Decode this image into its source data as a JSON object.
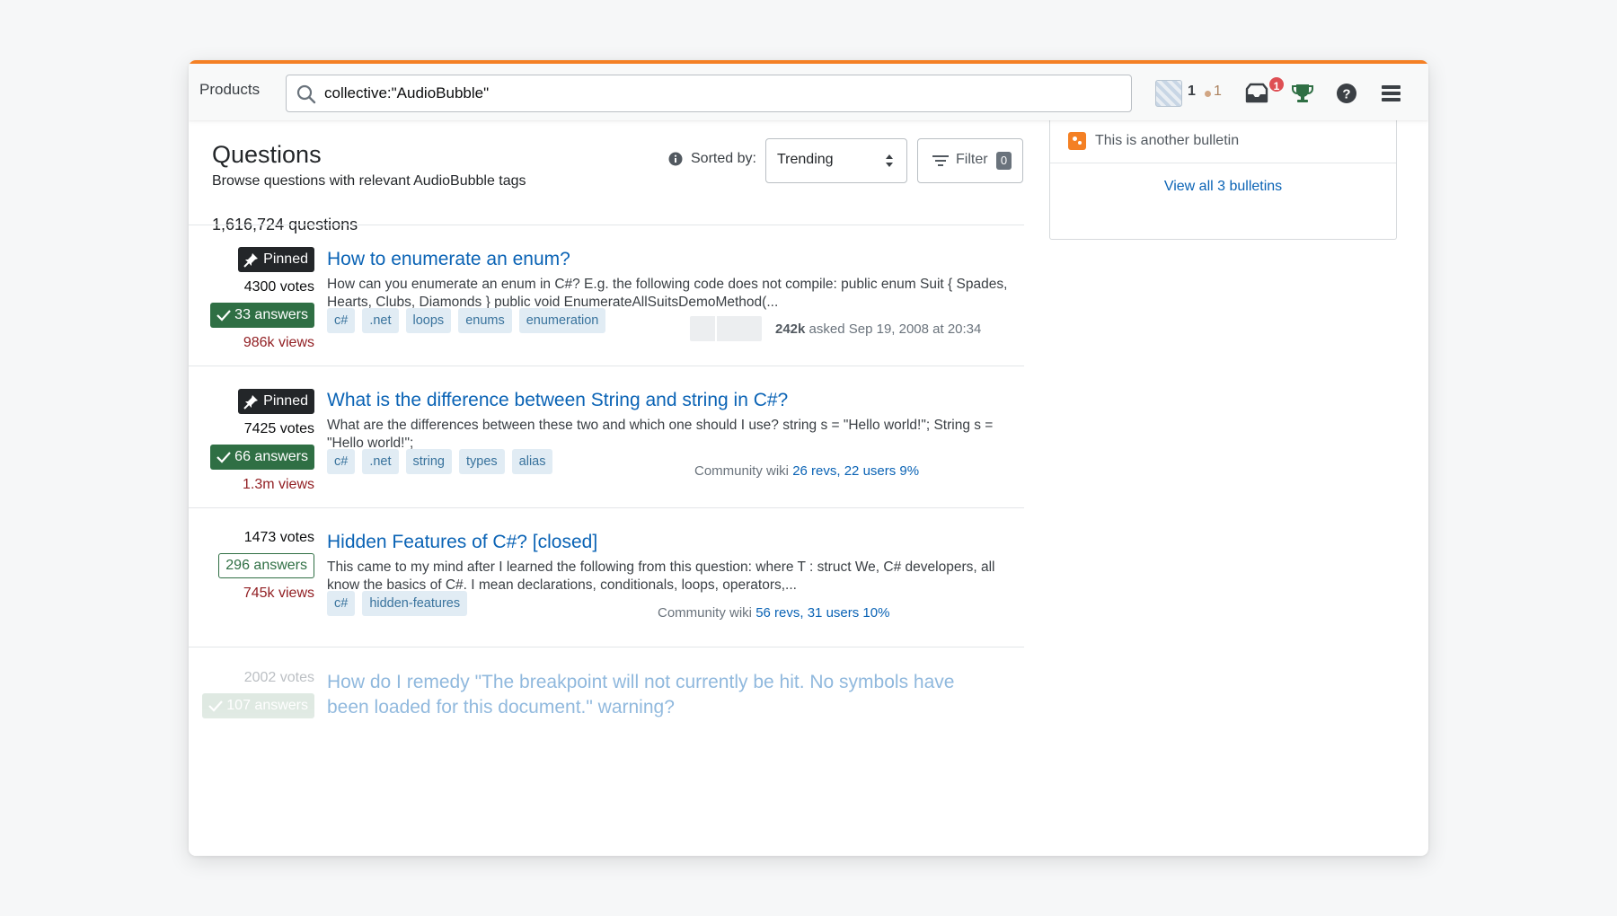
{
  "header": {
    "products_label": "Products",
    "search": {
      "value": "collective:\"AudioBubble\"",
      "placeholder": ""
    },
    "reputation": "1",
    "bronze_badges": "1",
    "inbox_count": "1",
    "icons": [
      "search-icon",
      "avatar",
      "inbox-icon",
      "trophy-icon",
      "help-icon",
      "hamburger-icon"
    ],
    "accent_color": "#f48024"
  },
  "main": {
    "title": "Questions",
    "subtitle": "Browse questions with relevant AudioBubble tags",
    "count": "1,616,724 questions",
    "sorted_by_label": "Sorted by:",
    "sort_value": "Trending",
    "filter_label": "Filter",
    "filter_count": "0"
  },
  "questions": [
    {
      "pinned_label": "Pinned",
      "votes": "4300 votes",
      "answers": "33 answers",
      "views": "986k views",
      "title": "How to enumerate an enum?",
      "excerpt": "How can you enumerate an enum in C#? E.g. the following code does not compile: public enum Suit { Spades, Hearts, Clubs, Diamonds } public void EnumerateAllSuitsDemoMethod(...",
      "tags": [
        "c#",
        ".net",
        "loops",
        "enums",
        "enumeration"
      ],
      "owner_rep": "242k",
      "owner_meta": "asked Sep 19, 2008 at 20:34"
    },
    {
      "pinned_label": "Pinned",
      "votes": "7425 votes",
      "answers": "66 answers",
      "views": "1.3m views",
      "title": "What is the difference between String and string in C#?",
      "excerpt": "What are the differences between these two and which one should I use? string s = \"Hello world!\"; String s = \"Hello world!\";",
      "tags": [
        "c#",
        ".net",
        "string",
        "types",
        "alias"
      ],
      "owner_prefix": "Community wiki",
      "owner_link": "26 revs, 22 users 9%"
    },
    {
      "votes": "1473 votes",
      "answers": "296 answers",
      "views": "745k views",
      "title": "Hidden Features of C#? [closed]",
      "excerpt": "This came to my mind after I learned the following from this question: where T : struct We, C# developers, all know the basics of C#. I mean declarations, conditionals, loops, operators,...",
      "tags": [
        "c#",
        "hidden-features"
      ],
      "owner_prefix": "Community wiki",
      "owner_link": "56 revs, 31 users 10%"
    },
    {
      "votes": "2002 votes",
      "answers": "107 answers",
      "title": "How do I remedy \"The breakpoint will not currently be hit. No symbols have been loaded for this document.\" warning?"
    }
  ],
  "sidebar": {
    "bulletin_text": "This is another bulletin",
    "view_all": "View all 3 bulletins"
  },
  "colors": {
    "link": "#0a63b5",
    "accepted_answer": "#2f6f44",
    "views": "#922024",
    "tag_bg": "#e1ecf4",
    "tag_text": "#39739d"
  }
}
